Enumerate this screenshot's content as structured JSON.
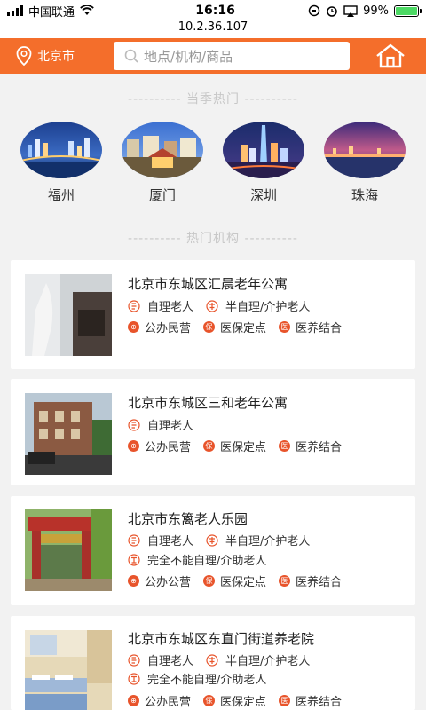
{
  "status_bar": {
    "carrier": "中国联通",
    "time": "16:16",
    "battery": "99%",
    "battery_level": 0.99,
    "ip": "10.2.36.107"
  },
  "header": {
    "city": "北京市",
    "search_placeholder": "地点/机构/商品"
  },
  "season_section": {
    "title": "---------- 当季热门 ----------"
  },
  "cities": [
    {
      "name": "福州"
    },
    {
      "name": "厦门"
    },
    {
      "name": "深圳"
    },
    {
      "name": "珠海"
    }
  ],
  "institution_section": {
    "title": "---------- 热门机构 ----------"
  },
  "institutions": [
    {
      "name": "北京市东城区汇晨老年公寓",
      "care_types": [
        "自理老人",
        "半自理/介护老人"
      ],
      "features": [
        "公办民营",
        "医保定点",
        "医养结合"
      ]
    },
    {
      "name": "北京市东城区三和老年公寓",
      "care_types": [
        "自理老人"
      ],
      "features": [
        "公办民营",
        "医保定点",
        "医养结合"
      ]
    },
    {
      "name": "北京市东篱老人乐园",
      "care_types": [
        "自理老人",
        "半自理/介护老人"
      ],
      "care_types_2": [
        "完全不能自理/介助老人"
      ],
      "features": [
        "公办公营",
        "医保定点",
        "医养结合"
      ]
    },
    {
      "name": "北京市东城区东直门街道养老院",
      "care_types": [
        "自理老人",
        "半自理/介护老人"
      ],
      "care_types_2": [
        "完全不能自理/介助老人"
      ],
      "features": [
        "公办民营",
        "医保定点",
        "医养结合"
      ]
    }
  ],
  "colors": {
    "accent": "#f46e2b",
    "tag_icon": "#e8542b"
  }
}
